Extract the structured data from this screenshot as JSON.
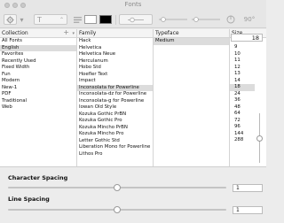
{
  "window": {
    "title": "Fonts"
  },
  "toolbar": {
    "text_icon": "text-align-icon",
    "text_color": "#ffffff",
    "doc_color": "#000000",
    "rotation": "90°"
  },
  "columns": {
    "collection": {
      "header": "Collection",
      "add_label": "+",
      "items": [
        "All Fonts",
        "English",
        "Favorites",
        "Recently Used",
        "Fixed Width",
        "Fun",
        "Modern",
        "New-1",
        "PDF",
        "Traditional",
        "Web"
      ],
      "selected": 1
    },
    "family": {
      "header": "Family",
      "items": [
        "Hack",
        "Helvetica",
        "Helvetica Neue",
        "Herculanum",
        "Hobo Std",
        "Hoefler Text",
        "Impact",
        "Inconsolata for Powerline",
        "Inconsolata-dz for Powerline",
        "Inconsolata-g for Powerline",
        "Iowan Old Style",
        "Kozuka Gothic PrBN",
        "Kozuka Gothic Pro",
        "Kozuka Mincho PrBN",
        "Kozuka Mincho Pro",
        "Letter Gothic Std",
        "Liberation Mono for Powerline",
        "Lithos Pro"
      ],
      "selected": 7
    },
    "typeface": {
      "header": "Typeface",
      "items": [
        "Medium"
      ],
      "selected": 0
    },
    "size": {
      "header": "Size",
      "value": "18",
      "items": [
        "9",
        "10",
        "11",
        "12",
        "13",
        "14",
        "18",
        "24",
        "36",
        "48",
        "64",
        "72",
        "96",
        "144",
        "288"
      ],
      "selected": 6
    }
  },
  "spacing": {
    "character_label": "Character Spacing",
    "character_value": "1",
    "line_label": "Line Spacing",
    "line_value": "1"
  }
}
